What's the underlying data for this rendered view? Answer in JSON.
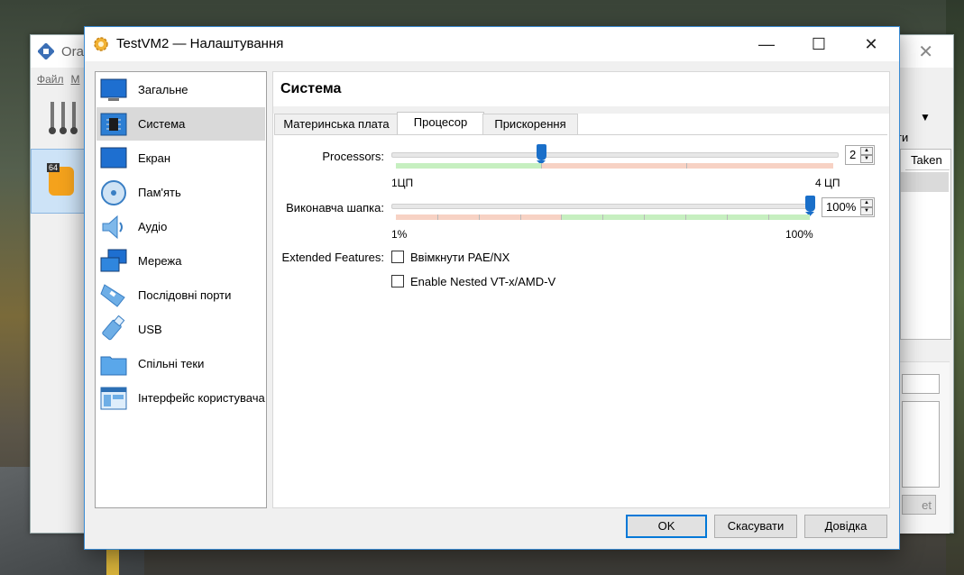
{
  "background_window": {
    "title": "Orac",
    "menu": [
      "Файл",
      "M"
    ],
    "right_label": "ти",
    "table_header": "Taken",
    "button_fragment": "et"
  },
  "dialog": {
    "title": "TestVM2 — Налаштування",
    "window_controls": {
      "minimize": "—",
      "maximize": "☐",
      "close": "✕"
    }
  },
  "sidebar": {
    "items": [
      {
        "label": "Загальне",
        "icon": "monitor-icon"
      },
      {
        "label": "Система",
        "icon": "chip-icon",
        "selected": true
      },
      {
        "label": "Екран",
        "icon": "display-icon"
      },
      {
        "label": "Пам'ять",
        "icon": "disk-icon"
      },
      {
        "label": "Аудіо",
        "icon": "speaker-icon"
      },
      {
        "label": "Мережа",
        "icon": "network-icon"
      },
      {
        "label": "Послідовні порти",
        "icon": "serial-port-icon"
      },
      {
        "label": "USB",
        "icon": "usb-icon"
      },
      {
        "label": "Спільні теки",
        "icon": "folder-icon"
      },
      {
        "label": "Інтерфейс користувача",
        "icon": "ui-window-icon"
      }
    ]
  },
  "pane": {
    "title": "Система",
    "tabs": [
      {
        "label": "Материнська плата"
      },
      {
        "label": "Процесор",
        "active": true
      },
      {
        "label": "Прискорення"
      }
    ]
  },
  "processor": {
    "processors_label": "Processors:",
    "processors_value": "2",
    "processors_min_label": "1ЦП",
    "processors_max_label": "4 ЦП",
    "processors_slider_fraction": 0.333,
    "cap_label": "Виконавча шапка:",
    "cap_value": "100%",
    "cap_min_label": "1%",
    "cap_max_label": "100%",
    "cap_slider_fraction": 1.0,
    "extended_label": "Extended Features:",
    "pae_label": "Ввімкнути PAE/NX",
    "pae_checked": false,
    "nested_label": "Enable Nested VT-x/AMD-V",
    "nested_checked": false
  },
  "buttons": {
    "ok": "OK",
    "cancel": "Скасувати",
    "help": "Довідка"
  },
  "colors": {
    "accent": "#0078d7",
    "slider_handle": "#1a6fc9",
    "scale_good": "#c6efc0",
    "scale_bad": "#f7d2c4",
    "selection": "#d9d9d9"
  }
}
